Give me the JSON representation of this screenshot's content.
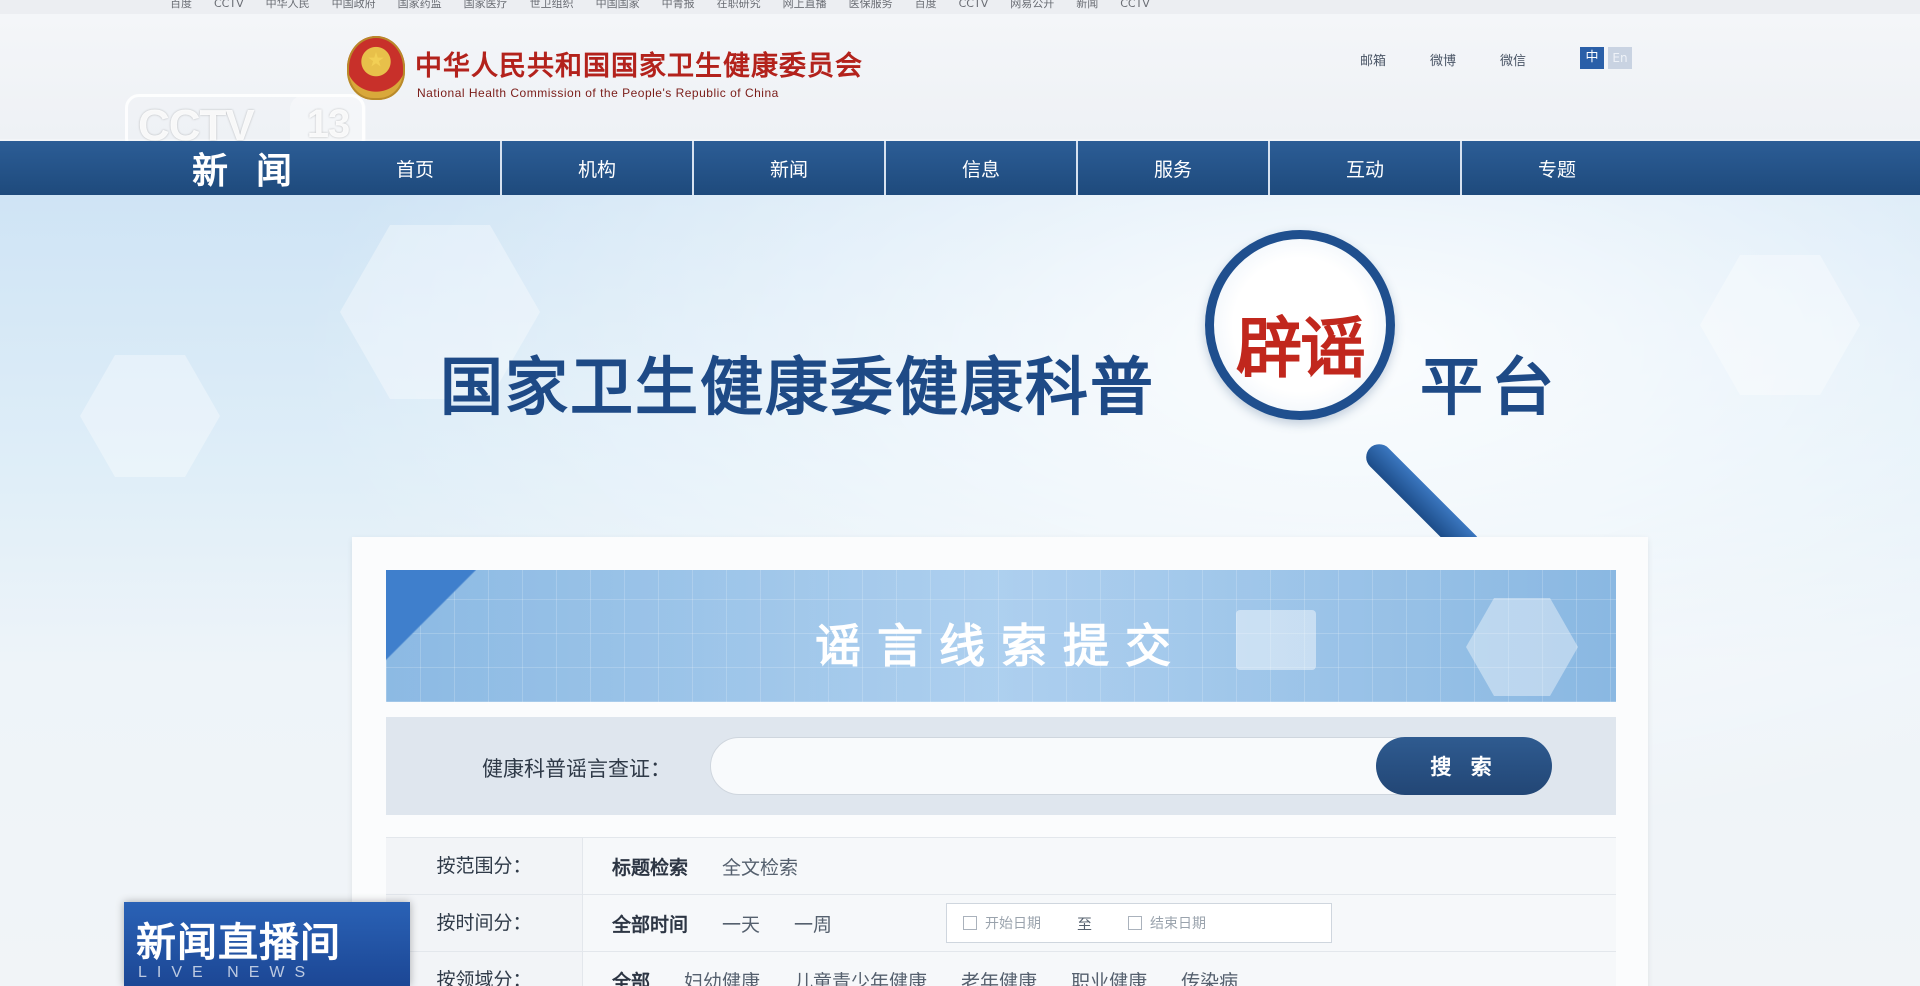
{
  "bookmarks": [
    "百度",
    "CCTV",
    "中华人民",
    "中国政府",
    "国家药监",
    "国家医疗",
    "世卫组织",
    "中国国家",
    "中青报",
    "在职研究",
    "网上直播",
    "医保服务",
    "百度",
    "CCTV",
    "网易公开",
    "新闻",
    "CCTV"
  ],
  "header": {
    "org_cn": "中华人民共和国国家卫生健康委员会",
    "org_en": "National Health Commission of the People's Republic of China",
    "links": [
      "邮箱",
      "微博",
      "微信"
    ],
    "lang_zh": "中",
    "lang_en": "En"
  },
  "overlay": {
    "channel_logo": "CCTV",
    "channel_num": "13",
    "program_cn": "新闻直播间",
    "program_en": "LIVE NEWS"
  },
  "nav": {
    "section": "新闻",
    "items": [
      "首页",
      "机构",
      "新闻",
      "信息",
      "服务",
      "互动",
      "专题"
    ]
  },
  "hero": {
    "title": "国家卫生健康委健康科普",
    "highlight": "辟谣",
    "title_end": "平台"
  },
  "panel": {
    "banner_title": "谣言线索提交",
    "search_label": "健康科普谣言查证：",
    "search_placeholder": "",
    "search_button": "搜 索",
    "filters": [
      {
        "label": "按范围分：",
        "options": [
          "标题检索",
          "全文检索"
        ],
        "active": 0
      },
      {
        "label": "按时间分：",
        "options": [
          "全部时间",
          "一天",
          "一周"
        ],
        "active": 0,
        "date_start": "开始日期",
        "date_sep": "至",
        "date_end": "结束日期"
      },
      {
        "label": "按领域分：",
        "options": [
          "全部",
          "妇幼健康",
          "儿童青少年健康",
          "老年健康",
          "职业健康",
          "传染病"
        ],
        "active": 0
      }
    ]
  },
  "colors": {
    "nav_blue": "#24548a",
    "title_blue": "#1e4a86",
    "accent_red": "#c1271d",
    "org_red": "#b3221c"
  }
}
